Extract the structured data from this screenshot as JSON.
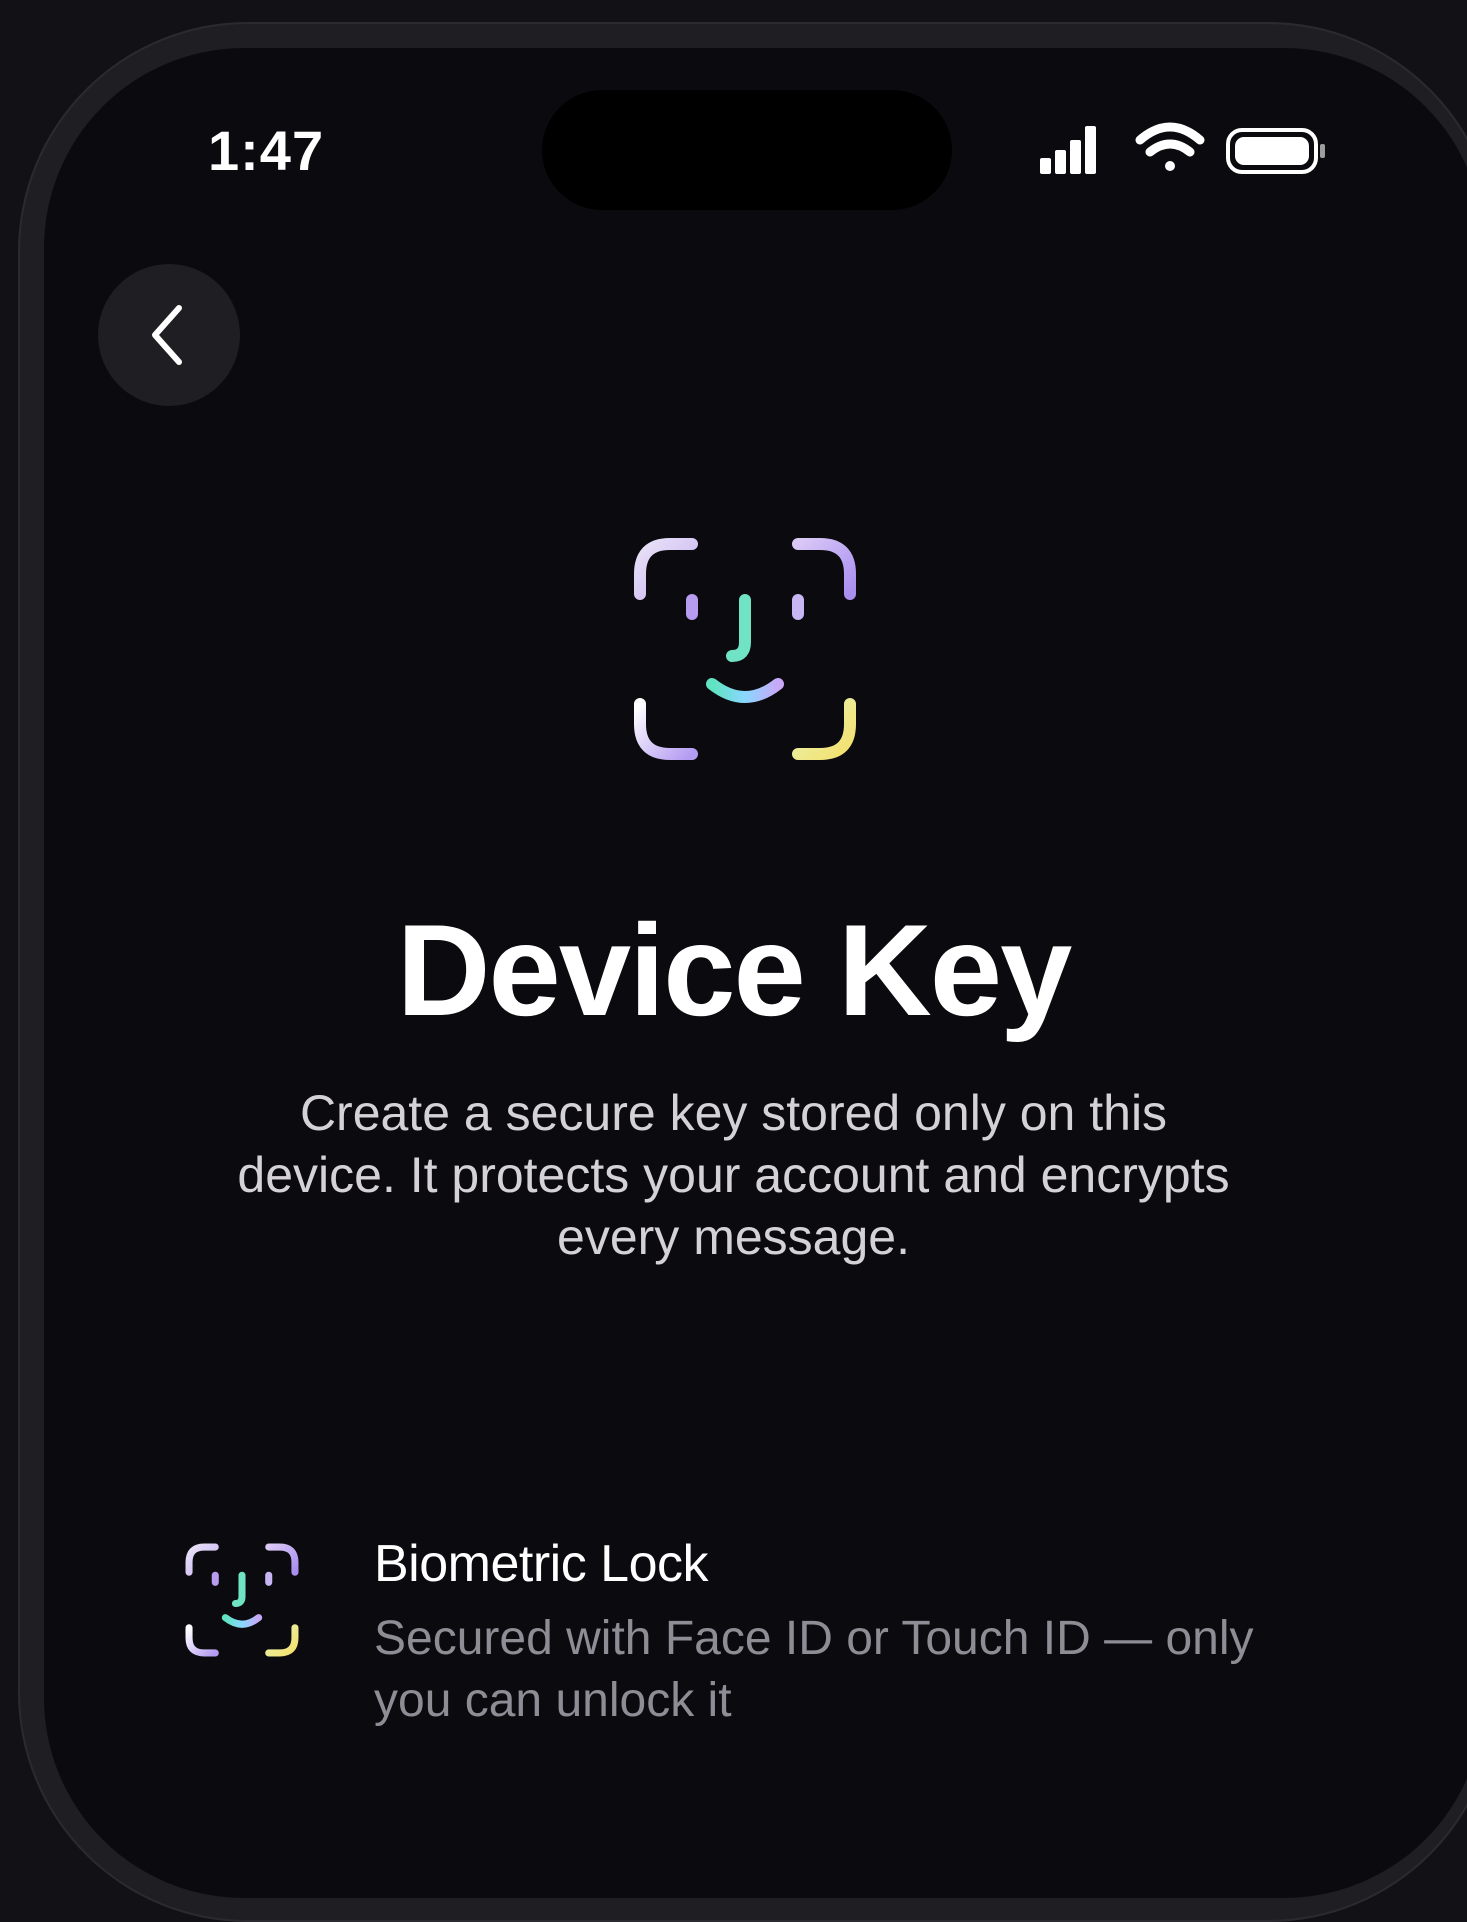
{
  "status_bar": {
    "time": "1:47",
    "signal_icon": "cellular-signal-icon",
    "wifi_icon": "wifi-icon",
    "battery_icon": "battery-icon"
  },
  "nav": {
    "back_icon": "chevron-left-icon"
  },
  "hero": {
    "icon": "face-id-icon",
    "icon_colors": [
      "#d9cdf3",
      "#b79cf0",
      "#6ee0c2",
      "#8ad6ff",
      "#f2e27a"
    ]
  },
  "title": "Device Key",
  "subtitle": "Create a secure key stored only on this device. It protects your account and encrypts every message.",
  "features": [
    {
      "icon": "face-id-icon",
      "title": "Biometric Lock",
      "description": "Secured with Face ID or Touch ID — only you can unlock it"
    }
  ],
  "colors": {
    "background": "#0b0a0e",
    "frame": "#1f1e23",
    "text_primary": "#ffffff",
    "text_secondary": "#d4d2d8",
    "text_muted": "#8e8c94"
  }
}
